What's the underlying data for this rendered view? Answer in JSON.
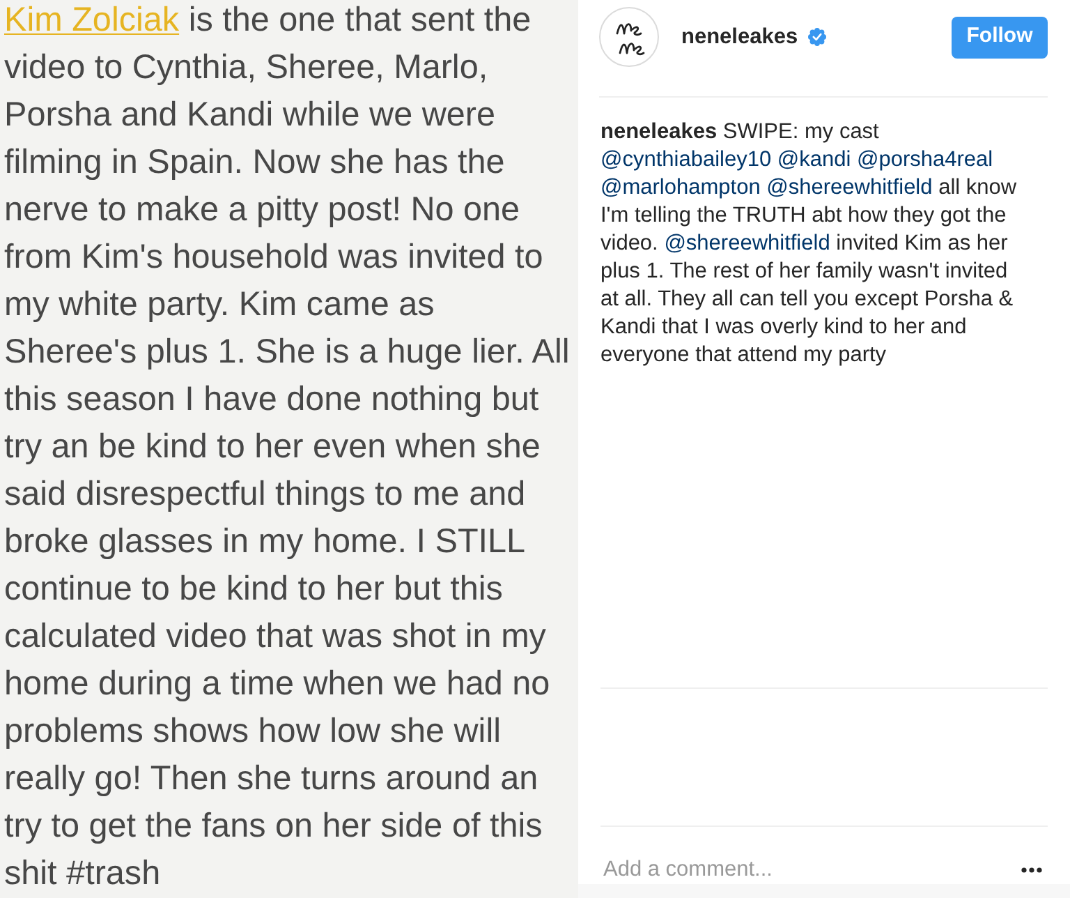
{
  "note": {
    "mention": "Kim Zolciak",
    "lines": [
      "is the one that sent the",
      "video to Cynthia, Sheree, Marlo,",
      "Porsha and Kandi while we were",
      "filming in Spain. Now she has the",
      "nerve to make a pitty post! No one",
      "from Kim's household was invited to",
      "my white party. Kim came as",
      "Sheree's plus 1. She is a huge lier. All",
      "this season I have done nothing but",
      "try an be kind to her even when she",
      "said disrespectful things to me and",
      "broke glasses in my home. I STILL",
      "continue to be kind to her but this",
      "calculated video that was shot in my",
      "home during a time when we had no",
      "problems shows how low she will",
      "really go! Then she turns around an",
      "try to get the fans on her side of this",
      "shit #trash"
    ]
  },
  "post": {
    "header": {
      "username": "neneleakes",
      "verified": true,
      "follow_button": "Follow"
    },
    "caption": [
      {
        "kind": "username",
        "text": "neneleakes"
      },
      {
        "kind": "text",
        "text": "SWIPE: my cast"
      },
      {
        "kind": "mention",
        "text": "@cynthiabailey10"
      },
      {
        "kind": "mention",
        "text": "@kandi"
      },
      {
        "kind": "mention",
        "text": "@porsha4real"
      },
      {
        "kind": "mention",
        "text": "@marlohampton"
      },
      {
        "kind": "mention",
        "text": "@shereewhitfield"
      },
      {
        "kind": "text",
        "text": "all know I'm telling the TRUTH abt how they got the video."
      },
      {
        "kind": "mention",
        "text": "@shereewhitfield"
      },
      {
        "kind": "text",
        "text": "invited Kim as her plus 1. The rest of her family wasn't invited at all. They all can tell you except Porsha & Kandi that I was overly kind to her and everyone that attend my party"
      }
    ],
    "comment_box": {
      "placeholder": "Add a comment..."
    }
  }
}
